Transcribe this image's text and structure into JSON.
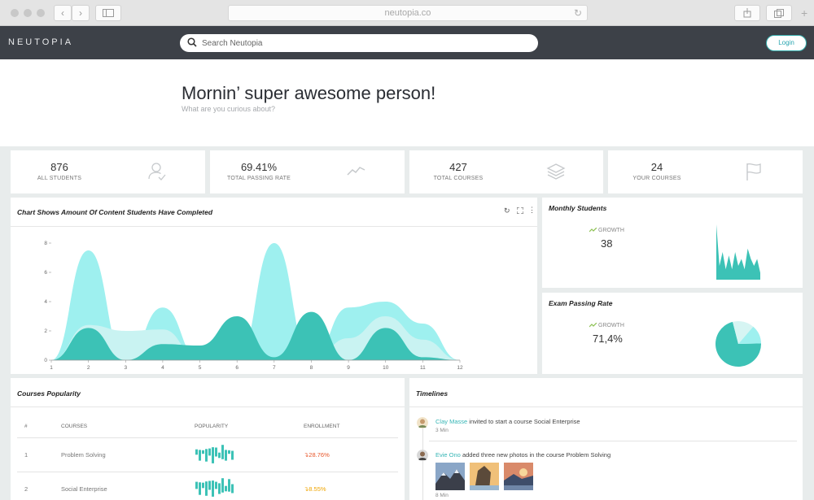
{
  "browser": {
    "url": "neutopia.co"
  },
  "header": {
    "logo": "NEUTOPIA",
    "search_placeholder": "Search Neutopia",
    "login_label": "Login"
  },
  "hero": {
    "greeting": "Mornin’ super awesome person!",
    "subtitle": "What are you curious about?"
  },
  "stats": [
    {
      "value": "876",
      "label": "ALL STUDENTS",
      "icon": "user-check-icon"
    },
    {
      "value": "69.41%",
      "label": "TOTAL PASSING RATE",
      "icon": "trend-line-icon"
    },
    {
      "value": "427",
      "label": "TOTAL COURSES",
      "icon": "layers-icon"
    },
    {
      "value": "24",
      "label": "YOUR COURSES",
      "icon": "flag-icon"
    }
  ],
  "main_chart": {
    "title": "Chart Shows Amount Of Content Students Have Completed",
    "chart_data": {
      "type": "area",
      "x": [
        1,
        2,
        3,
        4,
        5,
        6,
        7,
        8,
        9,
        10,
        11,
        12
      ],
      "xlim": [
        1,
        12
      ],
      "ylim": [
        0,
        8
      ],
      "yticks": [
        0,
        2,
        4,
        6,
        8
      ],
      "series": [
        {
          "color": "#9ef0ef",
          "values": [
            0,
            7.5,
            0,
            3.6,
            0,
            0,
            8,
            0,
            3.6,
            4,
            2.5,
            0
          ]
        },
        {
          "color": "#c9f3f2",
          "values": [
            0,
            2.4,
            2.0,
            2.1,
            0,
            0,
            0,
            0,
            1.5,
            3.0,
            1.4,
            0
          ]
        },
        {
          "color": "#3cc2b6",
          "values": [
            0,
            2.2,
            0,
            1.1,
            1.0,
            3.0,
            0.2,
            3.3,
            0,
            2.2,
            0.2,
            0
          ]
        }
      ]
    }
  },
  "monthly": {
    "title": "Monthly Students",
    "growth_label": "GROWTH",
    "value": "38",
    "chart_data": {
      "type": "area",
      "values": [
        8,
        2,
        4,
        1.5,
        3.5,
        1.5,
        4,
        2,
        3,
        1.5,
        4.5,
        3,
        2,
        3,
        1
      ]
    }
  },
  "exam": {
    "title": "Exam Passing Rate",
    "growth_label": "GROWTH",
    "value": "71,4%",
    "chart_data": {
      "type": "pie",
      "values": [
        71.4,
        13.3,
        15.3
      ],
      "colors": [
        "#3cc2b6",
        "#9ef0ef",
        "#d6f5f3"
      ]
    }
  },
  "courses": {
    "title": "Courses Popularity",
    "columns": [
      "#",
      "COURSES",
      "POPULARITY",
      "ENROLLMENT"
    ],
    "rows": [
      {
        "num": "1",
        "name": "Problem Solving",
        "enrollment": "28.76%",
        "trend_color": "#e8562a",
        "bars": [
          3,
          6,
          2,
          7,
          4,
          9,
          5,
          3,
          8,
          6,
          2,
          5
        ]
      },
      {
        "num": "2",
        "name": "Social Enterprise",
        "enrollment": "8.55%",
        "trend_color": "#f0a500",
        "bars": [
          4,
          7,
          3,
          8,
          5,
          9,
          4,
          6,
          8,
          3,
          7,
          5
        ]
      }
    ]
  },
  "timelines": {
    "title": "Timelines",
    "items": [
      {
        "name": "Clay Masse",
        "text": "invited to start a course Social Enterprise",
        "time": "3 Min"
      },
      {
        "name": "Evie Ono",
        "text": "added three new photos in the course Problem Solving",
        "time": "8 Min"
      }
    ]
  }
}
